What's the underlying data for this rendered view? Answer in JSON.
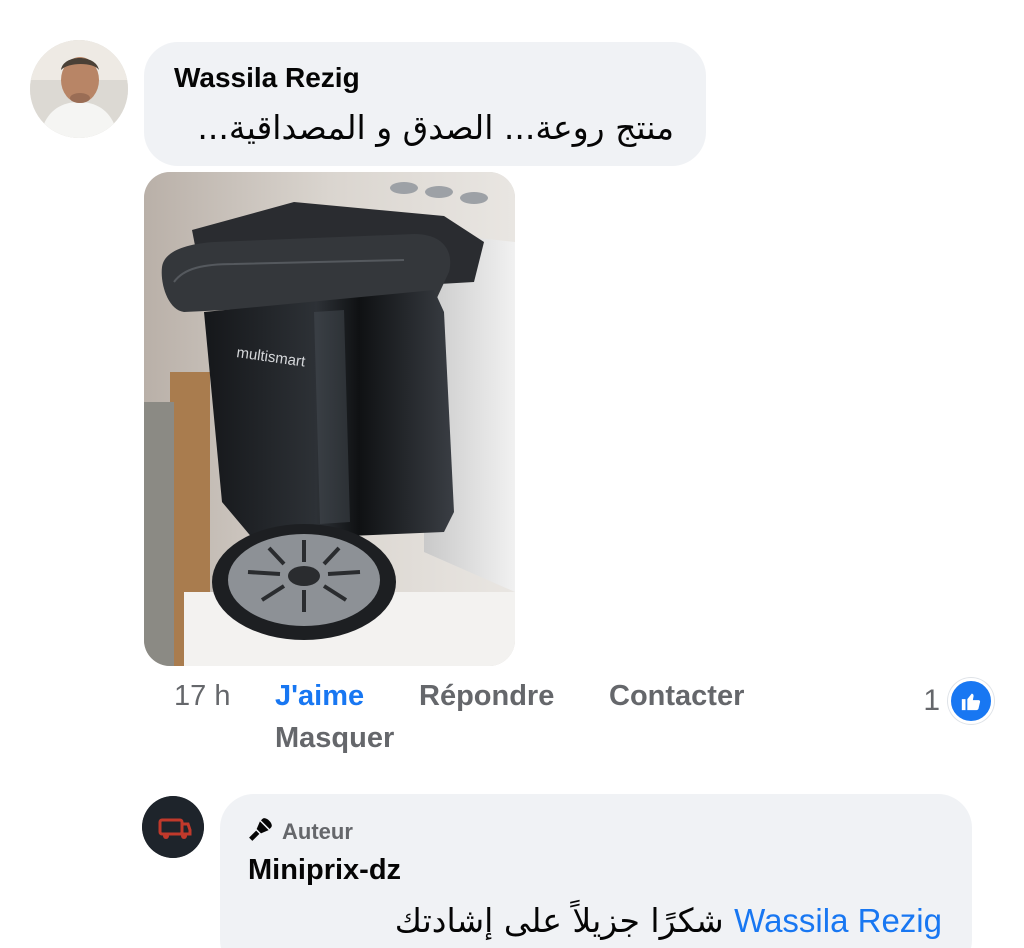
{
  "comment": {
    "author": "Wassila Rezig",
    "text": "منتج روعة... الصدق و المصداقية...",
    "photo": {
      "brand_text": "multismart"
    }
  },
  "actions": {
    "time": "17 h",
    "like": "J'aime",
    "reply": "Répondre",
    "contact": "Contacter",
    "hide": "Masquer",
    "reaction_count": "1"
  },
  "reply": {
    "badge": "Auteur",
    "author": "Miniprix-dz",
    "mention": "Wassila Rezig",
    "text": "شكرًا جزيلاً على إشادتك"
  },
  "icons": {
    "reaction": "like-thumb-icon",
    "badge": "microphone-icon"
  },
  "colors": {
    "accent": "#1877f2",
    "bubble": "#f0f2f5",
    "muted": "#65676b",
    "text": "#050505"
  }
}
